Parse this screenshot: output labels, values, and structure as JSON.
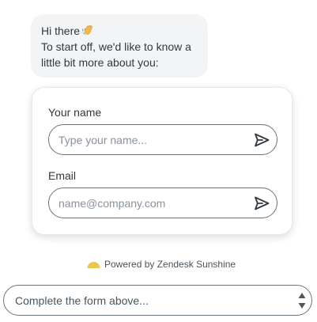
{
  "bubble": {
    "greeting": "Hi there",
    "greeting_icon": "waving-hand-icon",
    "line2": "To start off, we'd like to know a",
    "line3": "little bit more about you:"
  },
  "form": {
    "name_label": "Your name",
    "name_placeholder": "Type your name...",
    "name_value": "",
    "email_label": "Email",
    "email_placeholder": "name@company.com",
    "email_value": "",
    "send_icon": "send-icon"
  },
  "footer": {
    "powered_by": "Powered by Zendesk Sunshine",
    "logo_icon": "zendesk-sun-icon",
    "logo_color": "#E7C84A"
  },
  "composer": {
    "placeholder": "Complete the form above...",
    "value": ""
  },
  "colors": {
    "bubble_bg": "#F3F4F6",
    "text": "#2F3941",
    "border": "#68737D"
  }
}
